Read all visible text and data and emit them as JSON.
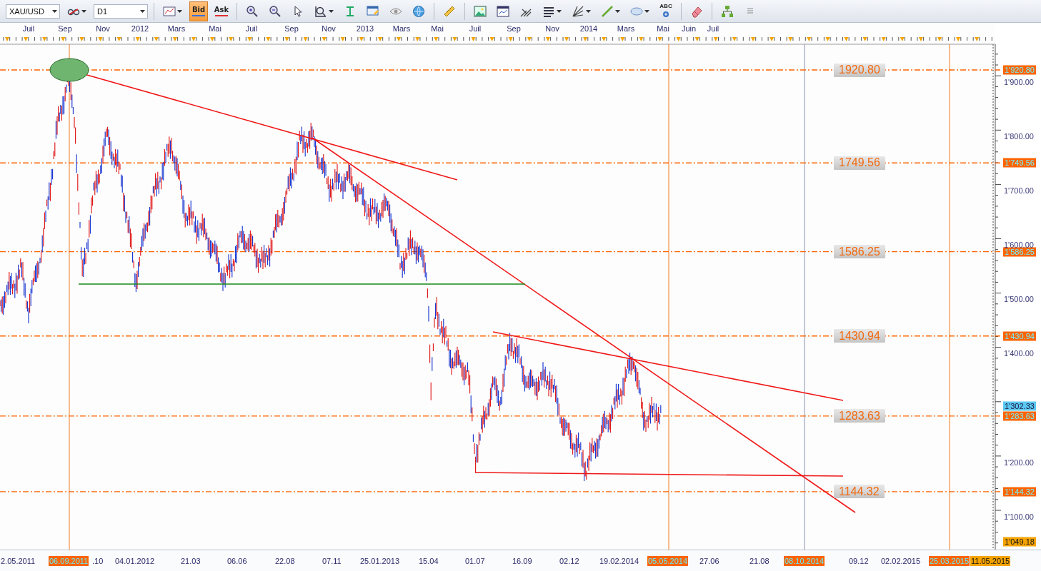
{
  "toolbar": {
    "symbol": "XAU/USD",
    "timeframe": "D1",
    "price_buttons": [
      {
        "label": "Bid",
        "selected": true
      },
      {
        "label": "Ask",
        "selected": false
      }
    ],
    "text_tool_label": "ABC"
  },
  "time_axis_top": {
    "labels": [
      "Juil",
      "Sep",
      "Nov",
      "2012",
      "Mars",
      "Mai",
      "Juil",
      "Sep",
      "Nov",
      "2013",
      "Mars",
      "Mai",
      "Juil",
      "Sep",
      "Nov",
      "2014",
      "Mars",
      "Mai",
      "Juin",
      "Juil"
    ]
  },
  "levels": [
    {
      "label": "1920.80",
      "axis_tag": "1'920.80"
    },
    {
      "label": "1749.56",
      "axis_tag": "1'749.56"
    },
    {
      "label": "1586.25",
      "axis_tag": "1'586.25"
    },
    {
      "label": "1430.94",
      "axis_tag": "1'430.94"
    },
    {
      "label": "1283.63",
      "axis_tag": "1'283.63"
    },
    {
      "label": "1144.32",
      "axis_tag": "1'144.32"
    }
  ],
  "price_axis": {
    "labels": [
      "1'900.00",
      "1'800.00",
      "1'700.00",
      "1'600.00",
      "1'500.00",
      "1'400.00",
      "1'200.00",
      "1'100.00"
    ],
    "tags": [
      {
        "text": "1'302.33",
        "kind": "current"
      },
      {
        "text": "1'049.18",
        "kind": "last"
      }
    ]
  },
  "time_axis_bottom": {
    "labels": [
      {
        "text": "2.05.2011",
        "kind": "plain"
      },
      {
        "text": "06.09.2011",
        "kind": "marker"
      },
      {
        "text": ".10",
        "kind": "plain"
      },
      {
        "text": "04.01.2012",
        "kind": "plain"
      },
      {
        "text": "21.03",
        "kind": "plain"
      },
      {
        "text": "06.06",
        "kind": "plain"
      },
      {
        "text": "22.08",
        "kind": "plain"
      },
      {
        "text": "07.11",
        "kind": "plain"
      },
      {
        "text": "25.01.2013",
        "kind": "plain"
      },
      {
        "text": "15.04",
        "kind": "plain"
      },
      {
        "text": "01.07",
        "kind": "plain"
      },
      {
        "text": "16.09",
        "kind": "plain"
      },
      {
        "text": "02.12",
        "kind": "plain"
      },
      {
        "text": "19.02.2014",
        "kind": "plain"
      },
      {
        "text": "05.05.2014",
        "kind": "marker"
      },
      {
        "text": "27.06",
        "kind": "plain"
      },
      {
        "text": "21.08",
        "kind": "plain"
      },
      {
        "text": "08.10.2014",
        "kind": "marker"
      },
      {
        "text": "09.12",
        "kind": "plain"
      },
      {
        "text": "02.02.2015",
        "kind": "plain"
      },
      {
        "text": "25.03.2015",
        "kind": "marker"
      },
      {
        "text": "11.05.2015",
        "kind": "end"
      }
    ]
  }
}
